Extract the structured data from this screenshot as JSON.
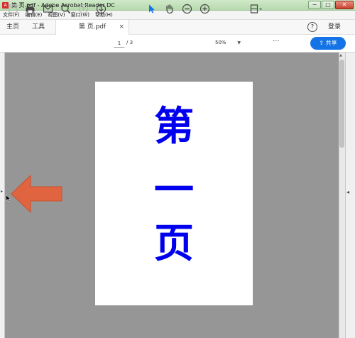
{
  "window": {
    "title": "第 页.pdf - Adobe Acrobat Reader DC",
    "app_icon_glyph": "A",
    "minimize": "−",
    "maximize": "□",
    "close": "✕"
  },
  "menu": {
    "items": [
      "文件(F)",
      "编辑(E)",
      "视图(V)",
      "窗口(W)",
      "帮助(H)"
    ]
  },
  "tabs": {
    "home": "主页",
    "tools": "工具",
    "document": "第 页.pdf",
    "document_close": "×"
  },
  "header": {
    "help_icon": "?",
    "login": "登录"
  },
  "toolbar": {
    "icons": [
      "save-icon",
      "print-icon",
      "email-icon",
      "search-icon",
      "prev-page-icon",
      "next-page-icon",
      "select-cursor-icon",
      "hand-icon",
      "zoom-out-icon",
      "zoom-in-icon",
      "fit-page-icon",
      "more-icon"
    ],
    "current_page": "1",
    "total_pages": "/ 3",
    "zoom": "50%",
    "more": "···",
    "share": "共享"
  },
  "document": {
    "chars": [
      "第",
      "一",
      "页"
    ],
    "text_color": "#0000ee"
  },
  "colors": {
    "accent": "#1473e6",
    "viewport_bg": "#969696",
    "arrow": "#e0643f"
  }
}
